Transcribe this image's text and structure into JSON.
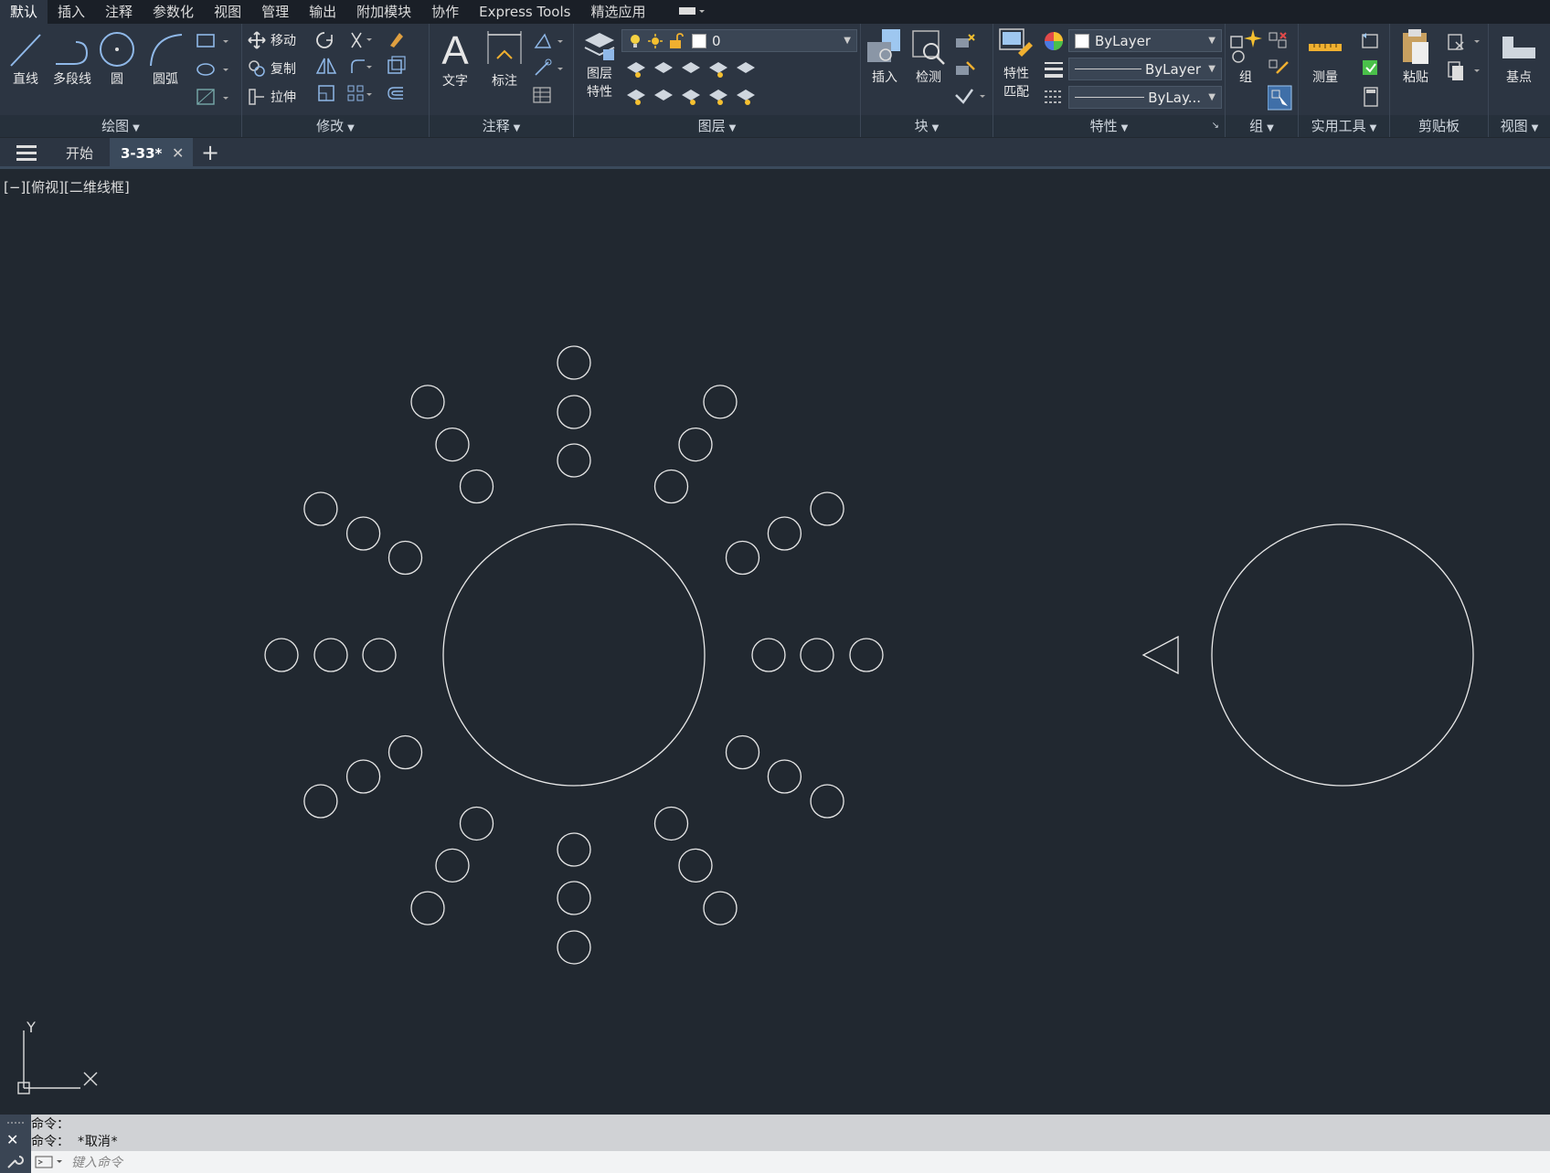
{
  "menubar": {
    "items": [
      "默认",
      "插入",
      "注释",
      "参数化",
      "视图",
      "管理",
      "输出",
      "附加模块",
      "协作",
      "Express Tools",
      "精选应用"
    ]
  },
  "ribbon": {
    "draw": {
      "title": "绘图",
      "line": "直线",
      "polyline": "多段线",
      "circle": "圆",
      "arc": "圆弧"
    },
    "modify": {
      "title": "修改",
      "move": "移动",
      "copy": "复制",
      "stretch": "拉伸"
    },
    "annotate": {
      "title": "注释",
      "text": "文字",
      "dimension": "标注"
    },
    "layers": {
      "title": "图层",
      "layer_props_1": "图层",
      "layer_props_2": "特性",
      "current_layer": "0"
    },
    "block": {
      "title": "块",
      "insert": "插入",
      "detect": "检测"
    },
    "properties": {
      "title": "特性",
      "match_1": "特性",
      "match_2": "匹配",
      "color": "ByLayer",
      "lineweight": "ByLayer",
      "linetype": "ByLay..."
    },
    "groups": {
      "title": "组",
      "group": "组"
    },
    "utilities": {
      "title": "实用工具",
      "measure": "测量"
    },
    "clipboard": {
      "title": "剪贴板",
      "paste": "粘贴"
    },
    "view": {
      "title": "视图",
      "basepoint": "基点"
    }
  },
  "tabs": {
    "start": "开始",
    "document": "3-33*"
  },
  "viewport": {
    "label": "[−][俯视][二维线框]"
  },
  "ucs": {
    "x": "X",
    "y": "Y"
  },
  "command": {
    "history": [
      "命令：",
      "命令：  *取消*"
    ],
    "placeholder": "键入命令"
  },
  "colors": {
    "canvas": "#212830",
    "ribbon": "#2c3542",
    "drawing_line": "#e8e8e8"
  }
}
